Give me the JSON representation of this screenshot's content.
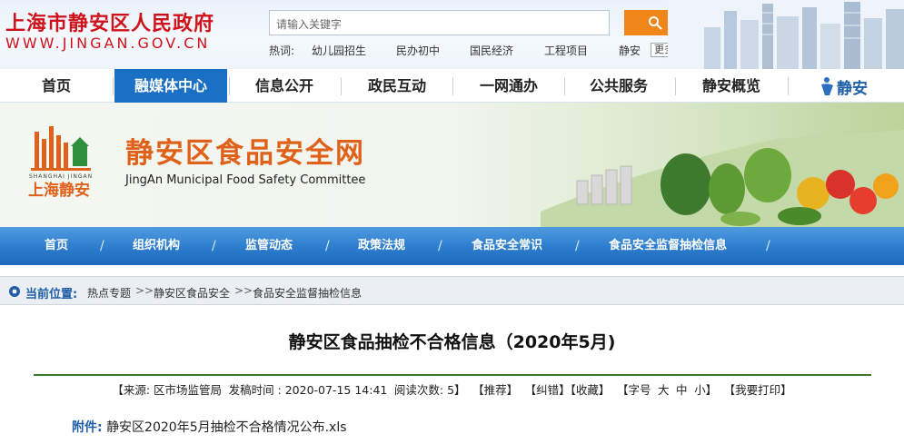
{
  "header": {
    "site_title": "上海市静安区人民政府",
    "site_url": "WWW.JINGAN.GOV.CN",
    "search_placeholder": "请输入关键字",
    "hot_label": "热词:",
    "hot_words": [
      "幼儿园招生",
      "民办初中",
      "国民经济",
      "工程项目",
      "静安"
    ],
    "more_label": "更多"
  },
  "main_nav": {
    "items": [
      "首页",
      "融媒体中心",
      "信息公开",
      "政民互动",
      "一网通办",
      "公共服务",
      "静安概览"
    ],
    "active_index": 1,
    "logo_text": "静安"
  },
  "banner": {
    "title": "静安区食品安全网",
    "subtitle": "JingAn Municipal Food Safety Committee",
    "logo_caption_top": "SHANGHAI JINGAN",
    "logo_caption_bottom": "上海静安"
  },
  "sub_nav": {
    "items": [
      "首页",
      "组织机构",
      "监管动态",
      "政策法规",
      "食品安全常识",
      "食品安全监督抽检信息"
    ],
    "separator": "/"
  },
  "breadcrumb": {
    "label": "当前位置:",
    "items": [
      "热点专题",
      "静安区食品安全",
      "食品安全监督抽检信息"
    ],
    "separator": ">>"
  },
  "article": {
    "title": "静安区食品抽检不合格信息（2020年5月)",
    "meta": {
      "source": "【来源: 区市场监管局",
      "publish": "发稿时间 : 2020-07-15 14:41",
      "views": "阅读次数: 5】",
      "recommend": "【推荐】",
      "error": "【纠错】",
      "favorite": "【收藏】",
      "font_prefix": "【字号",
      "font_large": "大",
      "font_medium": "中",
      "font_small": "小】",
      "print": "【我要打印】"
    },
    "attachment_label": "附件:",
    "attachment_file": "静安区2020年5月抽检不合格情况公布.xls"
  }
}
